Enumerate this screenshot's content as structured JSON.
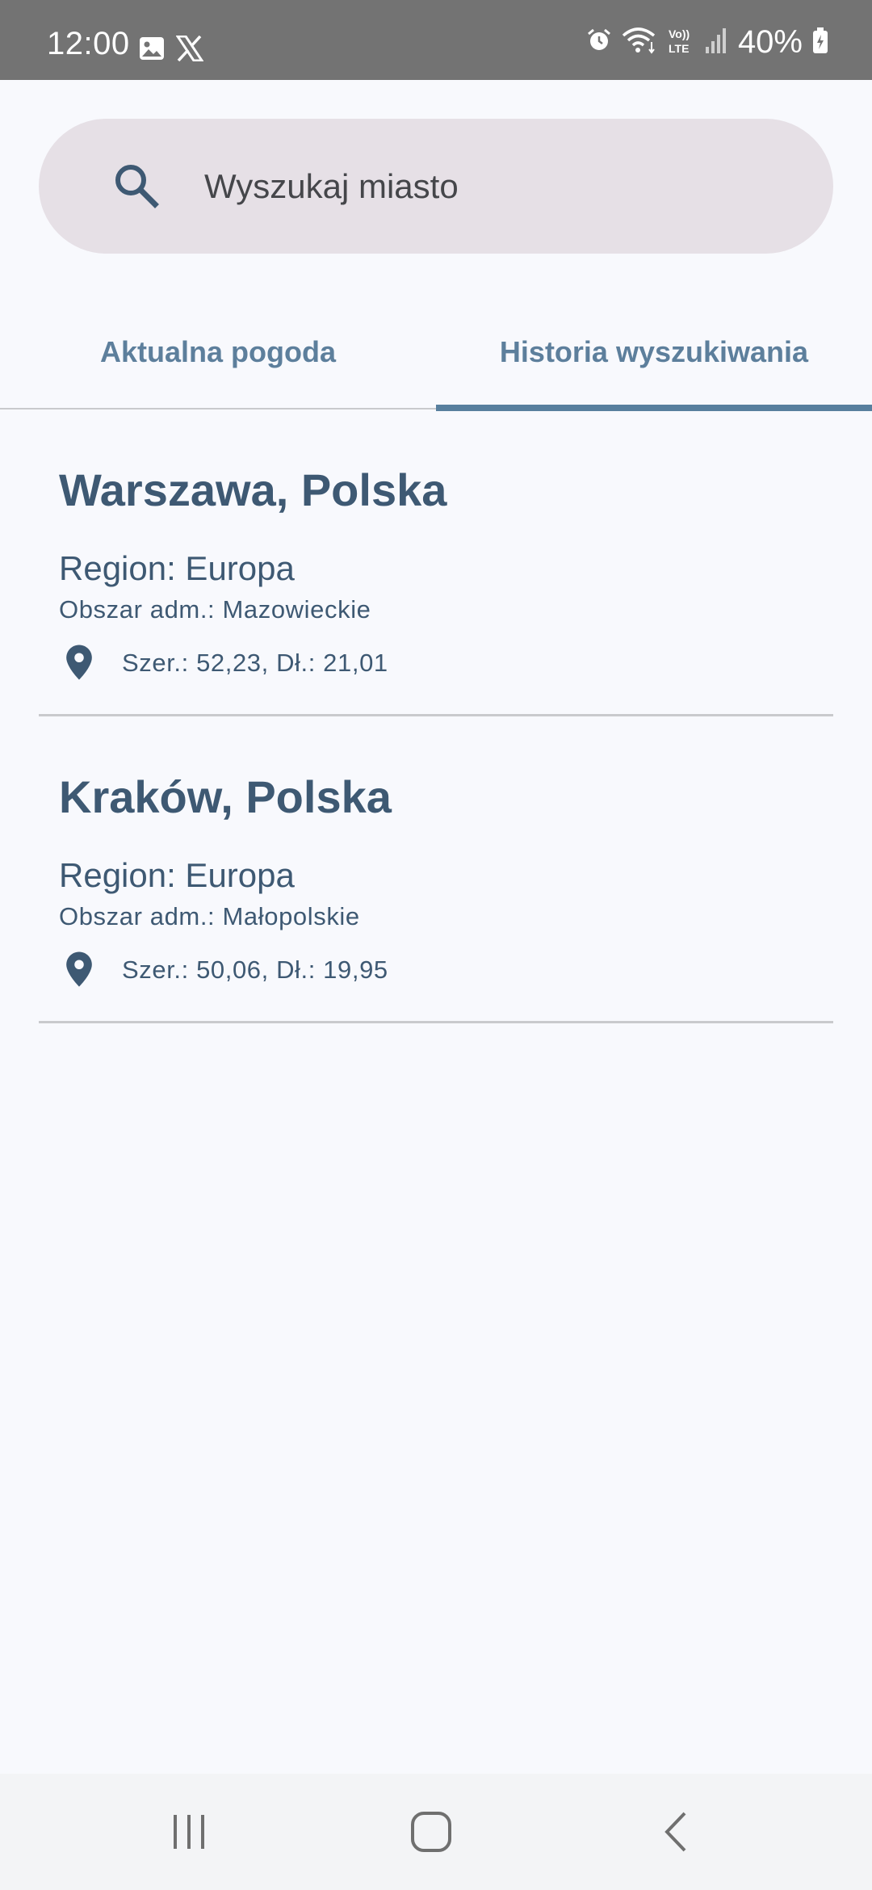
{
  "status_bar": {
    "time": "12:00",
    "battery": "40%",
    "left_icons": [
      "gallery-icon",
      "x-logo-icon"
    ],
    "right_icons": [
      "alarm-icon",
      "wifi-icon",
      "volte-icon",
      "signal-icon",
      "battery-icon"
    ]
  },
  "search": {
    "placeholder": "Wyszukaj miasto",
    "value": ""
  },
  "tabs": [
    {
      "label": "Aktualna pogoda",
      "selected": false
    },
    {
      "label": "Historia wyszukiwania",
      "selected": true
    }
  ],
  "history": [
    {
      "title": "Warszawa, Polska",
      "region": "Region: Europa",
      "admin": "Obszar adm.: Mazowieckie",
      "coords": "Szer.: 52,23, Dł.: 21,01"
    },
    {
      "title": "Kraków, Polska",
      "region": "Region: Europa",
      "admin": "Obszar adm.: Małopolskie",
      "coords": "Szer.: 50,06, Dł.: 19,95"
    }
  ],
  "colors": {
    "status_bar": "#737373",
    "background": "#f8f9fd",
    "search_bg": "#e6e0e6",
    "primary_text": "#3e5973",
    "tab_text": "#5d7f9c",
    "tab_indicator": "#587f9e",
    "divider": "#c9cacd"
  },
  "nav_bar": {
    "icons": [
      "recents-icon",
      "home-icon",
      "back-icon"
    ]
  }
}
